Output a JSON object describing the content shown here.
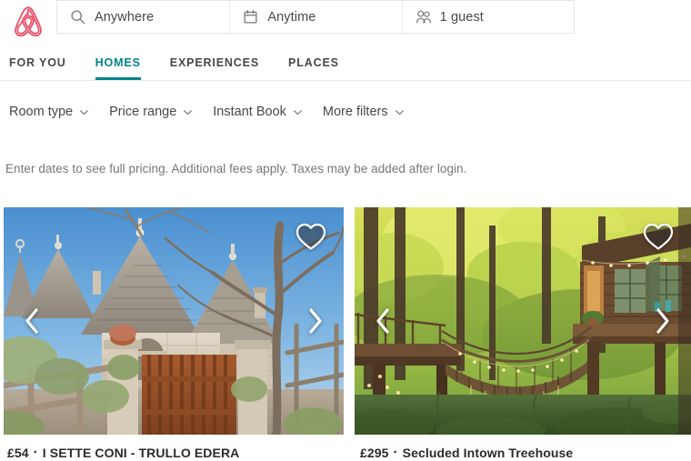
{
  "header": {
    "logo_icon": "airbnb-belo-logo",
    "logo_color": "#e8536a",
    "search": {
      "location": {
        "icon": "search-icon",
        "value": "Anywhere",
        "placeholder": "Anywhere"
      },
      "dates": {
        "icon": "calendar-icon",
        "value": "Anytime",
        "placeholder": "Anytime"
      },
      "guests": {
        "icon": "guests-icon",
        "value": "1 guest",
        "placeholder": "1 guest"
      }
    }
  },
  "nav": {
    "active_color": "#00848a",
    "tabs": [
      {
        "label": "FOR YOU",
        "active": false
      },
      {
        "label": "HOMES",
        "active": true
      },
      {
        "label": "EXPERIENCES",
        "active": false
      },
      {
        "label": "PLACES",
        "active": false
      }
    ]
  },
  "filters": {
    "chevron_icon": "chevron-down-icon",
    "items": [
      {
        "label": "Room type"
      },
      {
        "label": "Price range"
      },
      {
        "label": "Instant Book"
      },
      {
        "label": "More filters"
      }
    ]
  },
  "notice": {
    "text": "Enter dates to see full pricing. Additional fees apply. Taxes may be added after login."
  },
  "listings": {
    "separator": "·",
    "heart_icon": "heart-outline-icon",
    "prev_icon": "chevron-left-icon",
    "next_icon": "chevron-right-icon",
    "cards": [
      {
        "price": "£54",
        "title": "I SETTE CONI - TRULLO EDERA",
        "photo_alt": "trulli-stone-houses-with-conical-roofs-and-wooden-gate"
      },
      {
        "price": "£295",
        "title": "Secluded Intown Treehouse",
        "photo_alt": "treehouse-with-rope-bridge-and-string-lights-in-forest"
      }
    ]
  }
}
